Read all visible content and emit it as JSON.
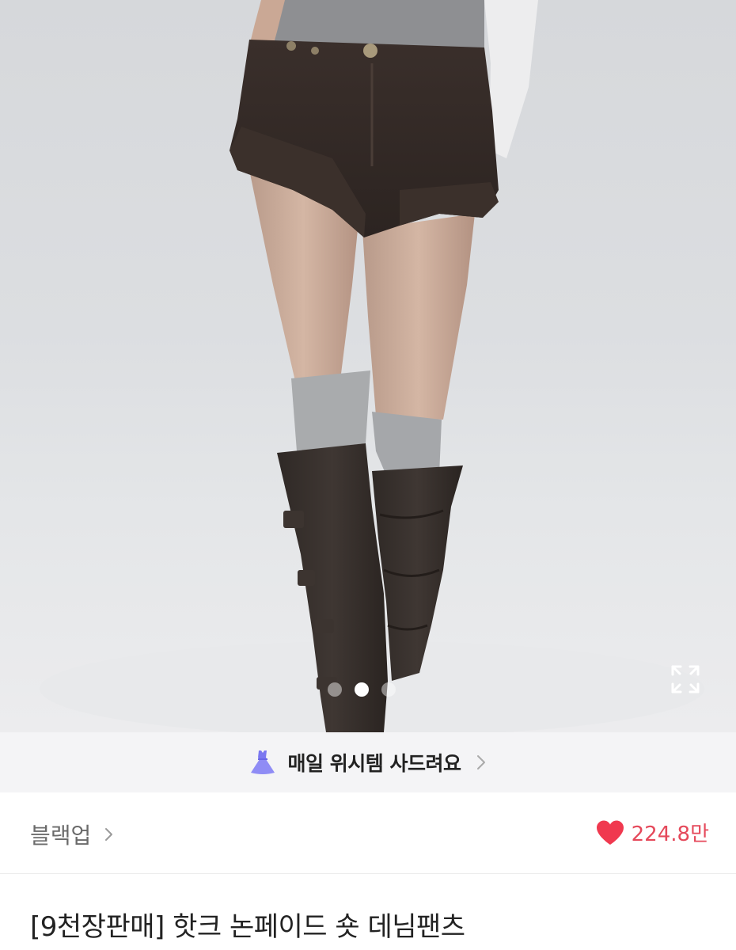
{
  "banner": {
    "icon": "dress-icon",
    "text": "매일 위시템 사드려요"
  },
  "carousel": {
    "total": 3,
    "active_index": 1
  },
  "shop": {
    "name": "블랙업"
  },
  "likes": {
    "icon": "heart-icon",
    "count": "224.8만",
    "color": "#e5495b"
  },
  "product": {
    "title": "[9천장판매] 핫크 논페이드 숏 데님팬츠"
  }
}
